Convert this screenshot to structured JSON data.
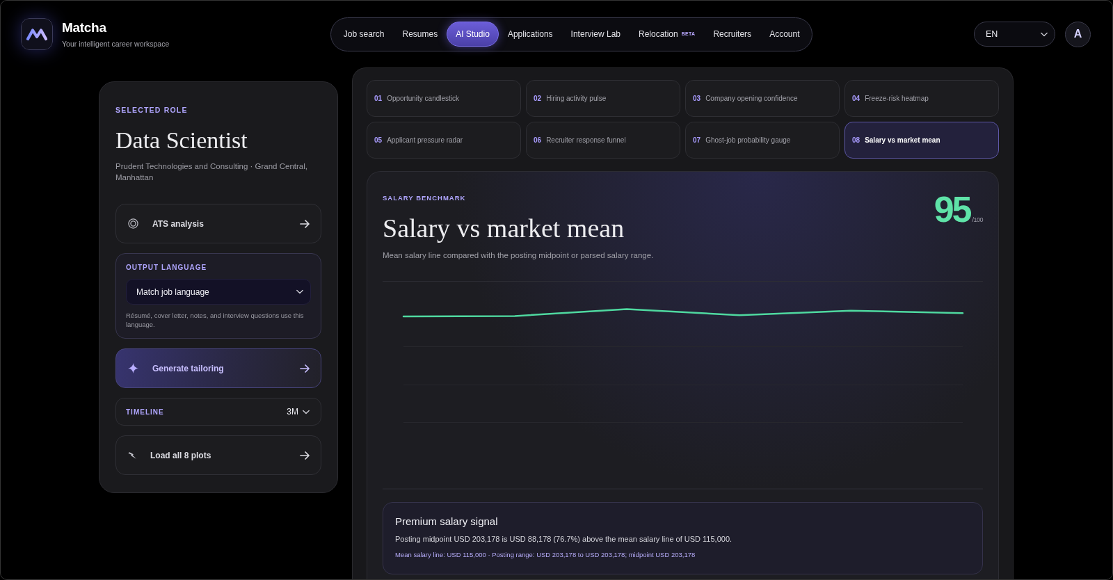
{
  "brand": {
    "name": "Matcha",
    "tagline": "Your intelligent career workspace"
  },
  "nav": [
    {
      "label": "Job search",
      "selected": false
    },
    {
      "label": "Resumes",
      "selected": false
    },
    {
      "label": "AI Studio",
      "selected": true
    },
    {
      "label": "Applications",
      "selected": false
    },
    {
      "label": "Interview Lab",
      "selected": false
    },
    {
      "label": "Relocation",
      "badge": "BETA",
      "selected": false
    },
    {
      "label": "Recruiters",
      "selected": false
    },
    {
      "label": "Account",
      "selected": false
    }
  ],
  "language_select": {
    "value": "EN"
  },
  "avatar": {
    "initial": "A"
  },
  "sidebar": {
    "eyebrow": "SELECTED ROLE",
    "title": "Data Scientist",
    "subtitle": "Prudent Technologies and Consulting · Grand Central, Manhattan",
    "blocks": [
      {
        "kind": "action",
        "label": "ATS analysis",
        "primary": false
      },
      {
        "kind": "language",
        "heading": "OUTPUT LANGUAGE",
        "value": "Match job language",
        "note": "Résumé, cover letter, notes, and interview questions use this language."
      },
      {
        "kind": "action",
        "label": "Generate tailoring",
        "primary": true
      },
      {
        "kind": "timeline",
        "heading": "TIMELINE",
        "value": "3M"
      },
      {
        "kind": "action",
        "label": "Load all 8 plots",
        "primary": false
      }
    ]
  },
  "plot_tabs": [
    {
      "number": "01",
      "label": "Opportunity candlestick",
      "selected": false
    },
    {
      "number": "02",
      "label": "Hiring activity pulse",
      "selected": false
    },
    {
      "number": "03",
      "label": "Company opening confidence",
      "selected": false
    },
    {
      "number": "04",
      "label": "Freeze-risk heatmap",
      "selected": false
    },
    {
      "number": "05",
      "label": "Applicant pressure radar",
      "selected": false
    },
    {
      "number": "06",
      "label": "Recruiter response funnel",
      "selected": false
    },
    {
      "number": "07",
      "label": "Ghost-job probability gauge",
      "selected": false
    },
    {
      "number": "08",
      "label": "Salary vs market mean",
      "selected": true
    }
  ],
  "plot": {
    "eyebrow": "SALARY BENCHMARK",
    "title": "Salary vs market mean",
    "description": "Mean salary line compared with the posting midpoint or parsed salary range.",
    "score": "95",
    "score_scale": "/100"
  },
  "signal": {
    "title": "Premium salary signal",
    "text": "Posting midpoint USD 203,178 is USD 88,178 (76.7%) above the mean salary line of USD 115,000.",
    "detail": "Mean salary line: USD 115,000 · Posting range: USD 203,178 to USD 203,178; midpoint USD 203,178"
  }
}
